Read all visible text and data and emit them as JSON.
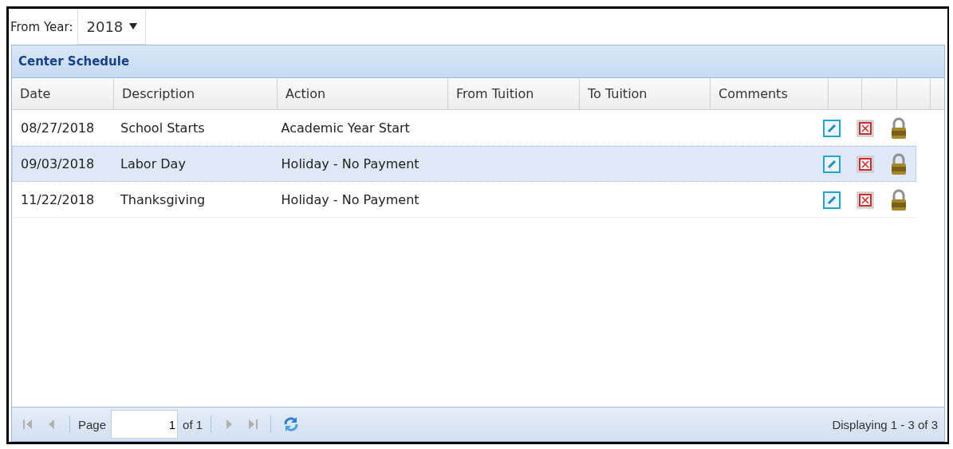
{
  "filter": {
    "label": "From Year:",
    "value": "2018"
  },
  "panel": {
    "title": "Center Schedule"
  },
  "table": {
    "columns": [
      "Date",
      "Description",
      "Action",
      "From Tuition",
      "To Tuition",
      "Comments"
    ],
    "rows": [
      {
        "cells": [
          "08/27/2018",
          "School Starts",
          "Academic Year Start",
          "",
          "",
          ""
        ],
        "selected": false
      },
      {
        "cells": [
          "09/03/2018",
          "Labor Day",
          "Holiday - No Payment",
          "",
          "",
          ""
        ],
        "selected": true
      },
      {
        "cells": [
          "11/22/2018",
          "Thanksgiving",
          "Holiday - No Payment",
          "",
          "",
          ""
        ],
        "selected": false
      }
    ]
  },
  "pager": {
    "page_label": "Page",
    "page": "1",
    "of": "of 1",
    "first_disabled": true,
    "prev_disabled": true,
    "next_disabled": true,
    "last_disabled": true,
    "status": "Displaying 1 - 3 of 3"
  }
}
